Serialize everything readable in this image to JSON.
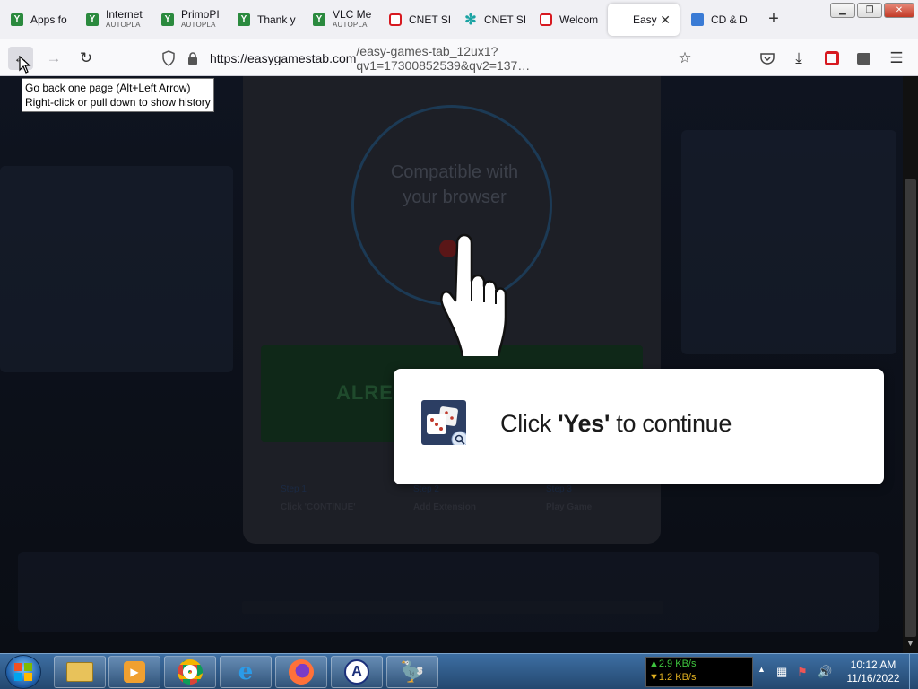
{
  "browser": {
    "tabs": [
      {
        "title": "Apps fo",
        "sub": "",
        "fav": "green-shield-icon"
      },
      {
        "title": "Internet",
        "sub": "AUTOPLA",
        "fav": "green-shield-icon"
      },
      {
        "title": "PrimoPI",
        "sub": "AUTOPLA",
        "fav": "green-shield-icon"
      },
      {
        "title": "Thank y",
        "sub": "",
        "fav": "green-shield-icon"
      },
      {
        "title": "VLC Me",
        "sub": "AUTOPLA",
        "fav": "green-shield-icon"
      },
      {
        "title": "CNET SI",
        "sub": "",
        "fav": "cnet-icon"
      },
      {
        "title": "CNET SI",
        "sub": "",
        "fav": "teal-icon"
      },
      {
        "title": "Welcom",
        "sub": "",
        "fav": "cnet-icon"
      },
      {
        "title": "Easy",
        "sub": "",
        "fav": "blank-icon",
        "active": true
      },
      {
        "title": "CD & D",
        "sub": "",
        "fav": "blue-icon"
      }
    ],
    "new_tab_label": "+",
    "url_host": "https://easygamestab.com",
    "url_path": "/easy-games-tab_12ux1?qv1=17300852539&qv2=137…",
    "back_tooltip_line1": "Go back one page (Alt+Left Arrow)",
    "back_tooltip_line2": "Right-click or pull down to show history"
  },
  "page": {
    "compat_text_line1": "Compatible with",
    "compat_text_line2": "your browser",
    "already_button_label": "ALRE",
    "steps": [
      {
        "num": "Step 1",
        "label": "Click 'CONTINUE'"
      },
      {
        "num": "Step 2",
        "label": "Add Extension"
      },
      {
        "num": "Step 3",
        "label": "Play Game"
      }
    ],
    "popup_prefix": "Click ",
    "popup_bold": "'Yes'",
    "popup_suffix": " to continue"
  },
  "taskbar": {
    "net_up": "▲2.9 KB/s",
    "net_down": "▼1.2 KB/s",
    "time": "10:12 AM",
    "date": "11/16/2022"
  },
  "colors": {
    "popup_bg": "#ffffff",
    "page_bg": "#0b0d12",
    "taskbar": "#24486f"
  }
}
